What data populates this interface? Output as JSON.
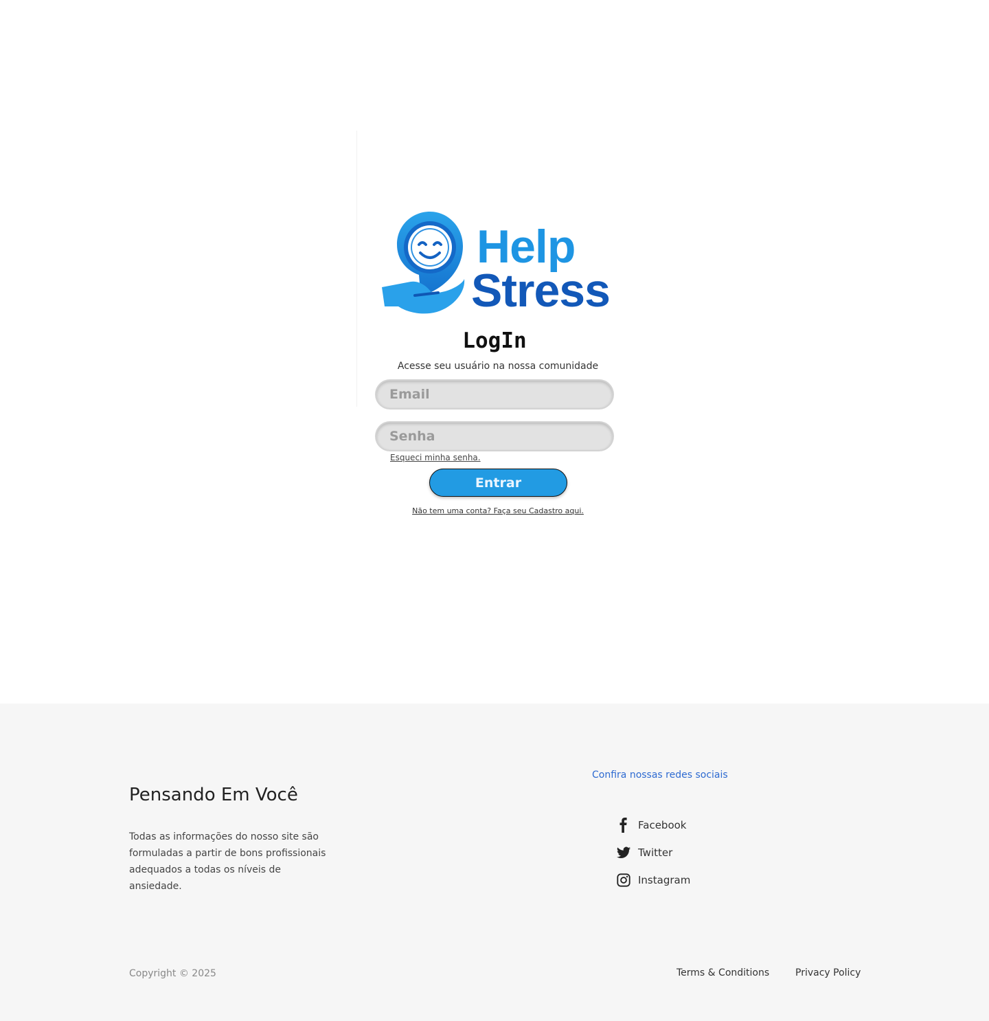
{
  "brand": {
    "logo_word_1": "Help",
    "logo_word_2": "Stress",
    "logo_icon": "smiling-face-in-hand-icon",
    "primary_color": "#229be3",
    "dark_color": "#1258b8"
  },
  "login": {
    "title": "LogIn",
    "subtitle": "Acesse seu usuário na nossa comunidade",
    "email_placeholder": "Email",
    "password_placeholder": "Senha",
    "forgot_password": "Esqueci minha senha.",
    "submit_label": "Entrar",
    "signup_link": "Não tem uma conta? Faça seu Cadastro aqui."
  },
  "footer": {
    "title": "Pensando Em Você",
    "description": "Todas as informações do nosso site são formuladas a partir de bons profissionais adequados a todas os níveis de ansiedade.",
    "social_heading": "Confira nossas redes sociais",
    "social": [
      {
        "label": "Facebook",
        "icon": "facebook-icon"
      },
      {
        "label": "Twitter",
        "icon": "twitter-icon"
      },
      {
        "label": "Instagram",
        "icon": "instagram-icon"
      }
    ],
    "copyright": "Copyright © 2025",
    "terms": "Terms & Conditions",
    "privacy": "Privacy Policy"
  }
}
